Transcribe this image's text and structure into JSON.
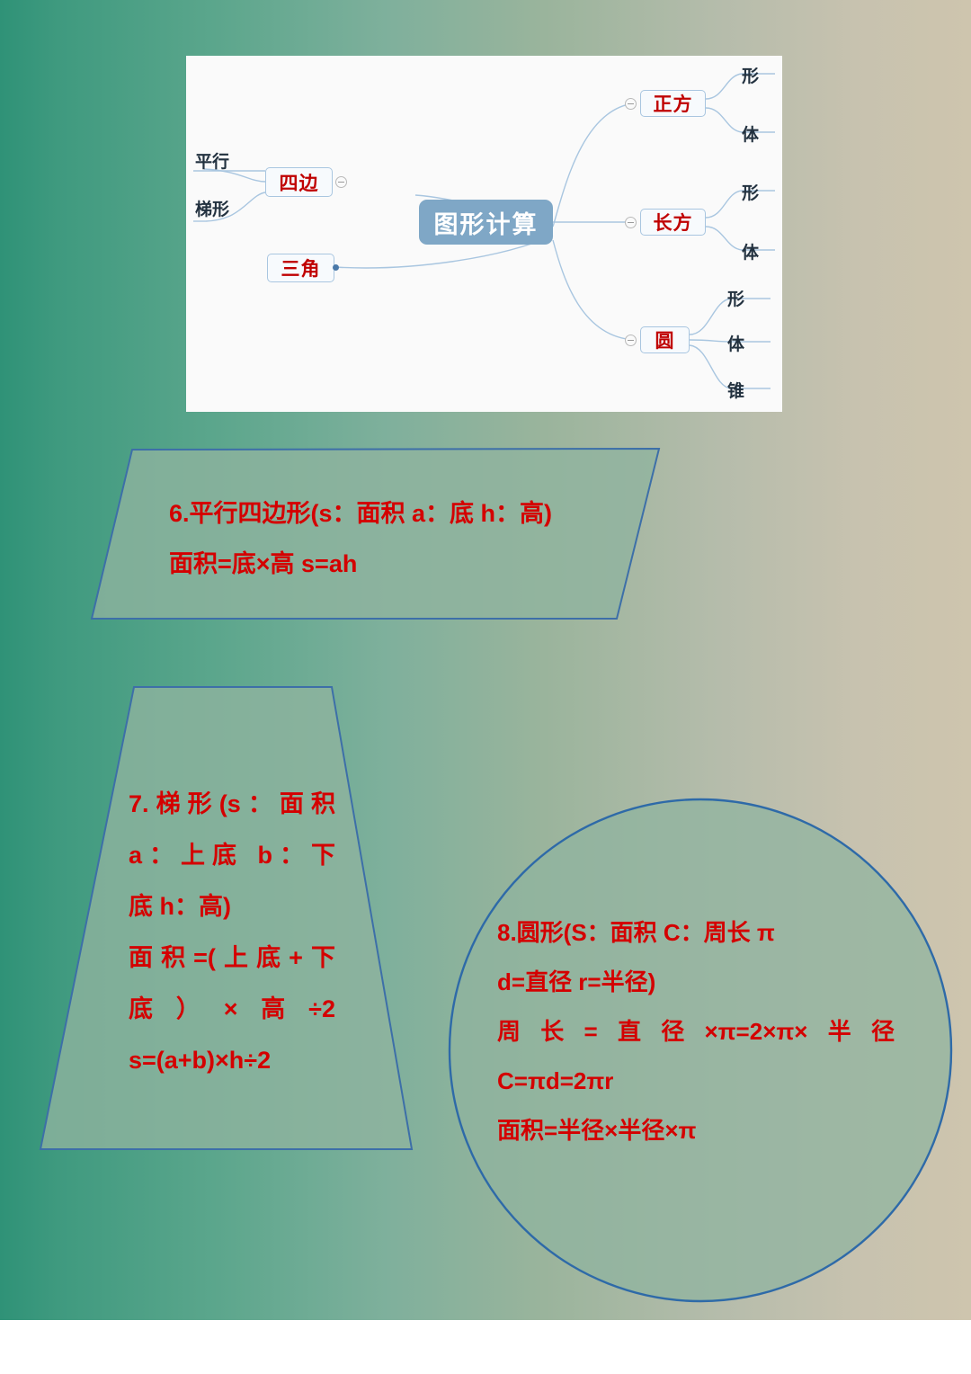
{
  "mindmap": {
    "center": {
      "label": "图形计算"
    },
    "left_branches": [
      {
        "label": "四边",
        "leaves": [
          "平行",
          "梯形"
        ]
      },
      {
        "label": "三角",
        "leaves": []
      }
    ],
    "right_branches": [
      {
        "label": "正方",
        "leaves": [
          "形",
          "体"
        ]
      },
      {
        "label": "长方",
        "leaves": [
          "形",
          "体"
        ]
      },
      {
        "label": "圆",
        "leaves": [
          "形",
          "体",
          "锥"
        ]
      }
    ]
  },
  "shapes": {
    "parallelogram": {
      "name": "平行四边形",
      "lines": [
        "6.平行四边形(s：面积 a：底 h：高)",
        "面积=底×高   s=ah"
      ]
    },
    "trapezoid": {
      "name": "梯形",
      "lines": [
        "7.梯形(s：面积",
        "a：上底  b：下",
        "底  h：高)",
        "面积=(上底+下",
        "底）×高÷2",
        "s=(a+b)×h÷2"
      ]
    },
    "circle": {
      "name": "圆形",
      "lines": [
        "8.圆形(S：面积  C：周长  π",
        "d=直径  r=半径)",
        "周长=直径×π=2×π×半径",
        "C=πd=2πr",
        "面积=半径×半径×π"
      ]
    }
  },
  "colors": {
    "formula_red": "#d40000",
    "node_red": "#c00000",
    "center_blue": "#7fa7c6",
    "link_blue": "#a9c6e0",
    "shape_stroke": "#3d6fa8",
    "shape_fill": "#8fb49f",
    "bg_left": "#2f9277",
    "bg_right": "#cec5ae",
    "panel_white": "#fafafa"
  }
}
